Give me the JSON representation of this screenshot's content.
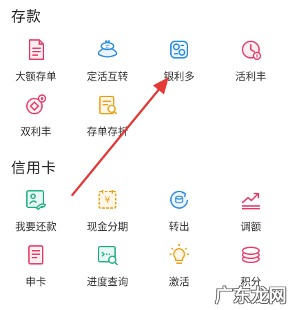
{
  "sections": {
    "deposit": {
      "title": "存款",
      "items": [
        {
          "label": "大额存单",
          "icon": "document-icon"
        },
        {
          "label": "定活互转",
          "icon": "coin-purse-icon"
        },
        {
          "label": "银利多",
          "icon": "coins-exchange-icon"
        },
        {
          "label": "活利丰",
          "icon": "clock-coin-icon"
        },
        {
          "label": "双利丰",
          "icon": "double-coin-icon"
        },
        {
          "label": "存单存折",
          "icon": "passbook-icon"
        }
      ]
    },
    "credit_card": {
      "title": "信用卡",
      "items": [
        {
          "label": "我要还款",
          "icon": "repay-icon"
        },
        {
          "label": "现金分期",
          "icon": "cash-installment-icon"
        },
        {
          "label": "转出",
          "icon": "transfer-out-icon"
        },
        {
          "label": "调额",
          "icon": "trend-chart-icon"
        },
        {
          "label": "申卡",
          "icon": "apply-card-icon"
        },
        {
          "label": "进度查询",
          "icon": "progress-search-icon"
        },
        {
          "label": "激活",
          "icon": "lightbulb-icon"
        },
        {
          "label": "积分",
          "icon": "points-icon"
        }
      ]
    }
  },
  "watermark": "广东龙网",
  "colors": {
    "pink": "#e8426b",
    "blue": "#2f8ee0",
    "orange": "#f0a31f",
    "green": "#2bb38a",
    "arrow": "#e53935"
  }
}
